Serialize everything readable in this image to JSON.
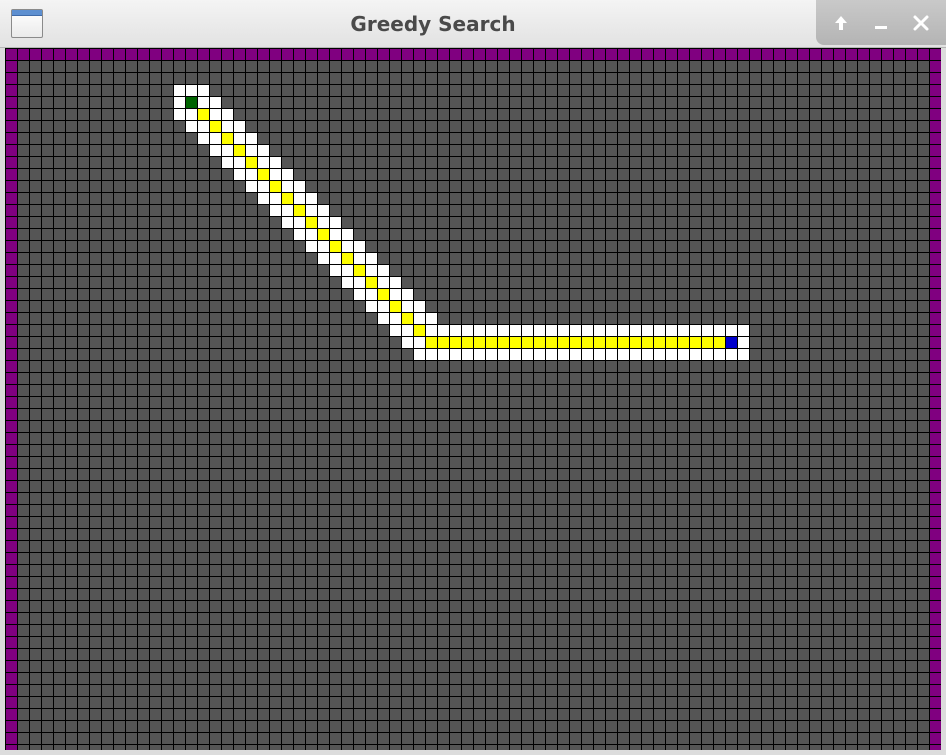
{
  "window": {
    "title": "Greedy Search"
  },
  "controls": {
    "maximize_icon": "up-arrow-icon",
    "minimize_icon": "minimize-icon",
    "close_icon": "close-icon"
  },
  "grid": {
    "cols": 78,
    "rows": 60,
    "colors": {
      "wall": "#800080",
      "empty": "#555555",
      "gridline": "#000000",
      "visited": "#ffffff",
      "path": "#ffff00",
      "start": "#006400",
      "goal": "#0000cd"
    },
    "start": [
      15,
      4
    ],
    "goal": [
      60,
      24
    ],
    "path": [
      [
        15,
        4
      ],
      [
        16,
        5
      ],
      [
        17,
        6
      ],
      [
        18,
        7
      ],
      [
        19,
        8
      ],
      [
        20,
        9
      ],
      [
        21,
        10
      ],
      [
        22,
        11
      ],
      [
        23,
        12
      ],
      [
        24,
        13
      ],
      [
        25,
        14
      ],
      [
        26,
        15
      ],
      [
        27,
        16
      ],
      [
        28,
        17
      ],
      [
        29,
        18
      ],
      [
        30,
        19
      ],
      [
        31,
        20
      ],
      [
        32,
        21
      ],
      [
        33,
        22
      ],
      [
        34,
        23
      ],
      [
        35,
        24
      ],
      [
        36,
        24
      ],
      [
        37,
        24
      ],
      [
        38,
        24
      ],
      [
        39,
        24
      ],
      [
        40,
        24
      ],
      [
        41,
        24
      ],
      [
        42,
        24
      ],
      [
        43,
        24
      ],
      [
        44,
        24
      ],
      [
        45,
        24
      ],
      [
        46,
        24
      ],
      [
        47,
        24
      ],
      [
        48,
        24
      ],
      [
        49,
        24
      ],
      [
        50,
        24
      ],
      [
        51,
        24
      ],
      [
        52,
        24
      ],
      [
        53,
        24
      ],
      [
        54,
        24
      ],
      [
        55,
        24
      ],
      [
        56,
        24
      ],
      [
        57,
        24
      ],
      [
        58,
        24
      ],
      [
        59,
        24
      ],
      [
        60,
        24
      ]
    ]
  }
}
